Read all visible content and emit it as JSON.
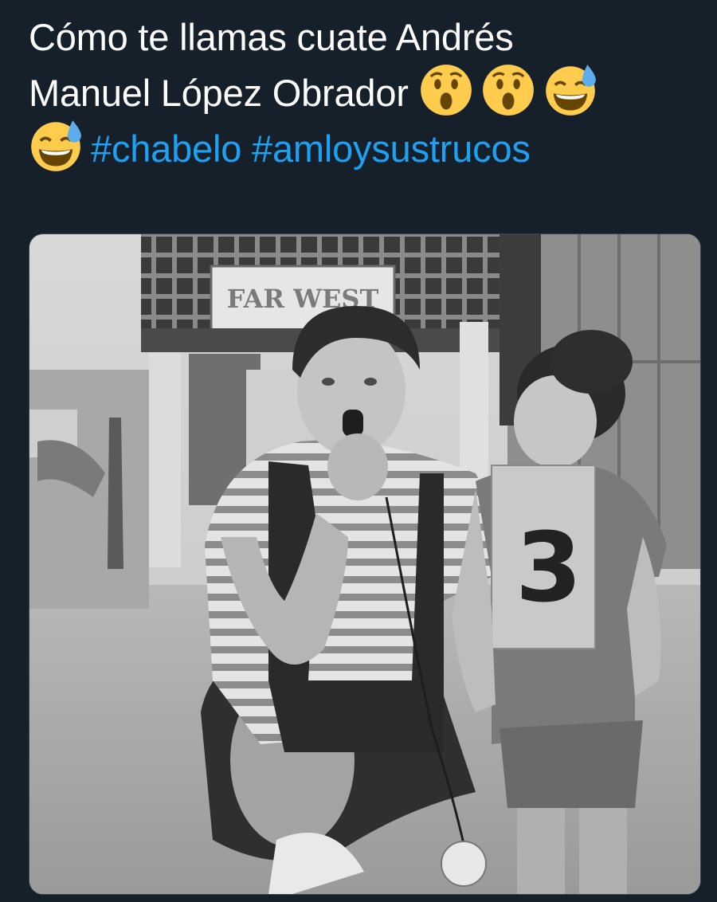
{
  "tweet": {
    "text_line1": "Cómo te llamas cuate Andrés",
    "text_line2": "Manuel López Obrador",
    "hashtags": [
      "#chabelo",
      "#amloysustrucos"
    ],
    "emojis": [
      "astonished-face-emoji",
      "astonished-face-emoji",
      "grinning-face-with-sweat-emoji",
      "grinning-face-with-sweat-emoji"
    ]
  },
  "photo": {
    "sign_text": "FAR WEST",
    "bib_number": "3"
  },
  "colors": {
    "background": "#15202b",
    "text": "#ffffff",
    "hashtag": "#1da1f2"
  }
}
